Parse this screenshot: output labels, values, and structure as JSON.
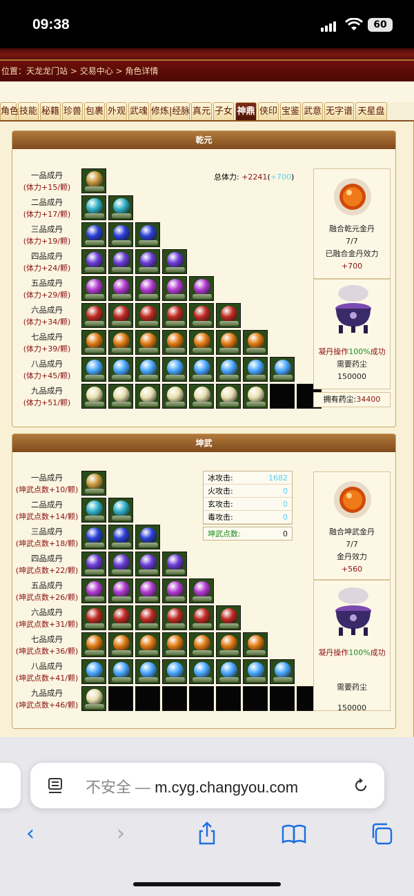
{
  "status_bar": {
    "time": "09:38",
    "battery": "60"
  },
  "breadcrumb": {
    "prefix": "位置：",
    "items": [
      "天龙龙门站",
      "交易中心",
      "角色详情"
    ],
    "sep": " > "
  },
  "tabs": [
    "角色",
    "技能",
    "秘籍",
    "珍兽",
    "包裹",
    "外观",
    "武魂",
    "修炼|经脉",
    "真元",
    "子女",
    "神鼎",
    "侠印",
    "宝鉴",
    "武意",
    "无字谱",
    "天星盘"
  ],
  "active_tab": "神鼎",
  "qianyuan": {
    "title": "乾元",
    "total_label": "总体力:",
    "total_value": "+2241",
    "total_bonus": "+700",
    "rows": [
      {
        "name": "一品成丹",
        "bonus": "(体力+15/颗)",
        "filled": 1,
        "empty": 0,
        "color": "#c99a3c"
      },
      {
        "name": "二品成丹",
        "bonus": "(体力+17/颗)",
        "filled": 2,
        "empty": 0,
        "color": "#2fb0c8"
      },
      {
        "name": "三品成丹",
        "bonus": "(体力+19/颗)",
        "filled": 3,
        "empty": 0,
        "color": "#2a3fd6"
      },
      {
        "name": "四品成丹",
        "bonus": "(体力+24/颗)",
        "filled": 4,
        "empty": 0,
        "color": "#6a3ad6"
      },
      {
        "name": "五品成丹",
        "bonus": "(体力+29/颗)",
        "filled": 5,
        "empty": 0,
        "color": "#b03ad0"
      },
      {
        "name": "六品成丹",
        "bonus": "(体力+34/颗)",
        "filled": 6,
        "empty": 0,
        "color": "#c02a22"
      },
      {
        "name": "七品成丹",
        "bonus": "(体力+39/颗)",
        "filled": 7,
        "empty": 0,
        "color": "#e07a12"
      },
      {
        "name": "八品成丹",
        "bonus": "(体力+45/颗)",
        "filled": 8,
        "empty": 0,
        "color": "#4aa8ff"
      },
      {
        "name": "九品成丹",
        "bonus": "(体力+51/颗)",
        "filled": 7,
        "empty": 2,
        "color": "#e8e0b0"
      }
    ],
    "fusion_title": "融合乾元金丹",
    "fusion_count": "7/7",
    "fusion_effect_label": "已融合金丹效力",
    "fusion_effect": "+700",
    "refine_pre": "凝丹操作",
    "refine_rate": "100%",
    "refine_post": "成功",
    "need_label": "需要药尘",
    "need_value": "150000",
    "owned_label": "拥有药尘:",
    "owned_value": "34400"
  },
  "kunwu": {
    "title": "坤武",
    "rows": [
      {
        "name": "一品成丹",
        "bonus": "(坤武点数+10/颗)",
        "filled": 1,
        "empty": 0,
        "color": "#c99a3c"
      },
      {
        "name": "二品成丹",
        "bonus": "(坤武点数+14/颗)",
        "filled": 2,
        "empty": 0,
        "color": "#2fb0c8"
      },
      {
        "name": "三品成丹",
        "bonus": "(坤武点数+18/颗)",
        "filled": 3,
        "empty": 0,
        "color": "#2a3fd6"
      },
      {
        "name": "四品成丹",
        "bonus": "(坤武点数+22/颗)",
        "filled": 4,
        "empty": 0,
        "color": "#6a3ad6"
      },
      {
        "name": "五品成丹",
        "bonus": "(坤武点数+26/颗)",
        "filled": 5,
        "empty": 0,
        "color": "#b03ad0"
      },
      {
        "name": "六品成丹",
        "bonus": "(坤武点数+31/颗)",
        "filled": 6,
        "empty": 0,
        "color": "#c02a22"
      },
      {
        "name": "七品成丹",
        "bonus": "(坤武点数+36/颗)",
        "filled": 7,
        "empty": 0,
        "color": "#e07a12"
      },
      {
        "name": "八品成丹",
        "bonus": "(坤武点数+41/颗)",
        "filled": 8,
        "empty": 0,
        "color": "#4aa8ff"
      },
      {
        "name": "九品成丹",
        "bonus": "(坤武点数+46/颗)",
        "filled": 1,
        "empty": 8,
        "color": "#e8e0b0"
      }
    ],
    "stats": [
      {
        "label": "冰攻击:",
        "value": "1682"
      },
      {
        "label": "火攻击:",
        "value": "0"
      },
      {
        "label": "玄攻击:",
        "value": "0"
      },
      {
        "label": "毒攻击:",
        "value": "0"
      }
    ],
    "points_label": "坤武点数:",
    "points_value": "0",
    "fusion_title": "融合坤武金丹",
    "fusion_count": "7/7",
    "fusion_effect_label": "金丹效力",
    "fusion_effect": "+560",
    "refine_pre": "凝丹操作",
    "refine_rate": "100%",
    "refine_post": "成功",
    "need_label": "需要药尘",
    "need_value": "150000"
  },
  "browser": {
    "insecure": "不安全 — ",
    "domain": "m.cyg.changyou.com"
  }
}
